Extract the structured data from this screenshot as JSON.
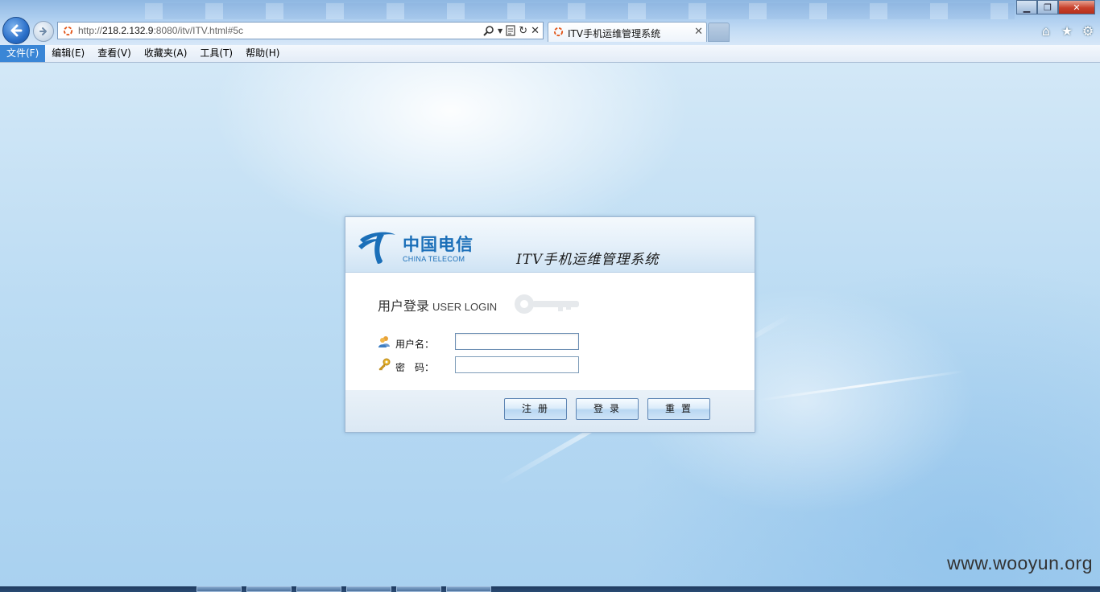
{
  "browser": {
    "address": {
      "prefix": "http://",
      "host": "218.2.132.9",
      "rest": ":8080/itv/ITV.html#5c"
    },
    "tab": {
      "title": "ITV手机运维管理系统"
    },
    "menu": [
      "文件(F)",
      "编辑(E)",
      "查看(V)",
      "收藏夹(A)",
      "工具(T)",
      "帮助(H)"
    ],
    "icons": {
      "back": "back-arrow-icon",
      "forward": "forward-arrow-icon",
      "search": "search-icon",
      "compat": "compatibility-view-icon",
      "refresh": "refresh-icon",
      "stop": "stop-icon",
      "home": "home-icon",
      "favorites": "star-icon",
      "tools": "gear-icon"
    }
  },
  "login": {
    "logo_cn": "中国电信",
    "logo_en": "CHINA TELECOM",
    "system_title": "ITV手机运维管理系统",
    "heading_cn": "用户登录",
    "heading_en": "USER LOGIN",
    "username_label": "用户名：",
    "password_label": "密　码：",
    "username_value": "",
    "password_value": "",
    "buttons": {
      "register": "注册",
      "login": "登录",
      "reset": "重置"
    }
  },
  "watermark": "www.wooyun.org",
  "colors": {
    "brand": "#1b6fb8",
    "menu_active": "#3a86d6",
    "close_button": "#c7402b"
  }
}
